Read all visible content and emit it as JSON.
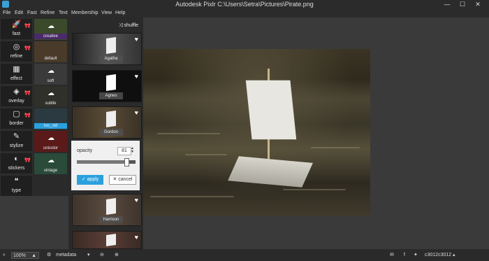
{
  "window": {
    "title": "Autodesk Pixlr   C:\\Users\\Setra\\Pictures\\Pirate.png",
    "minimize": "—",
    "maximize": "☐",
    "close": "✕"
  },
  "menu": [
    "File",
    "Edit",
    "Fast",
    "Refine",
    "Text",
    "Membership",
    "View",
    "Help"
  ],
  "tools": [
    {
      "label": "fast",
      "icon": "rocket-icon",
      "glyph": "🚀"
    },
    {
      "label": "refine",
      "icon": "aperture-icon",
      "glyph": "◎"
    },
    {
      "label": "effect",
      "icon": "film-icon",
      "glyph": "▦"
    },
    {
      "label": "overlay",
      "icon": "layers-icon",
      "glyph": "◈"
    },
    {
      "label": "border",
      "icon": "square-icon",
      "glyph": "▢"
    },
    {
      "label": "stylize",
      "icon": "brush-icon",
      "glyph": "✎"
    },
    {
      "label": "stickers",
      "icon": "sticker-icon",
      "glyph": "◐"
    },
    {
      "label": "type",
      "icon": "quote-icon",
      "glyph": "❝"
    }
  ],
  "favorite_icon": "🎀",
  "categories": [
    {
      "label": "creative",
      "color": "#3a4a2a"
    },
    {
      "label": "default",
      "color": "#4a3a2a"
    },
    {
      "label": "soft",
      "color": "#3a3a3a"
    },
    {
      "label": "subtle",
      "color": "#30302a"
    },
    {
      "label": "too_old",
      "color": "#2b6a8a",
      "selected": true
    },
    {
      "label": "unicolor",
      "color": "#5a1a1a"
    },
    {
      "label": "vintage",
      "color": "#2a4a3a"
    }
  ],
  "shuffle_label": "shuffle",
  "effects": [
    {
      "label": "Agatha",
      "bg": "#333333"
    },
    {
      "label": "Agnes",
      "bg": "#111111"
    },
    {
      "label": "Gordon",
      "bg": "#3a3226"
    },
    {
      "label": "Harrison",
      "bg": "#3e342c"
    }
  ],
  "opacity": {
    "label": "opacity",
    "value": "81",
    "apply_label": "apply",
    "cancel_label": "cancel",
    "level": 0.81
  },
  "status": {
    "zoom": "100%",
    "metadata_label": "metadata",
    "username": "c3012c3012"
  }
}
